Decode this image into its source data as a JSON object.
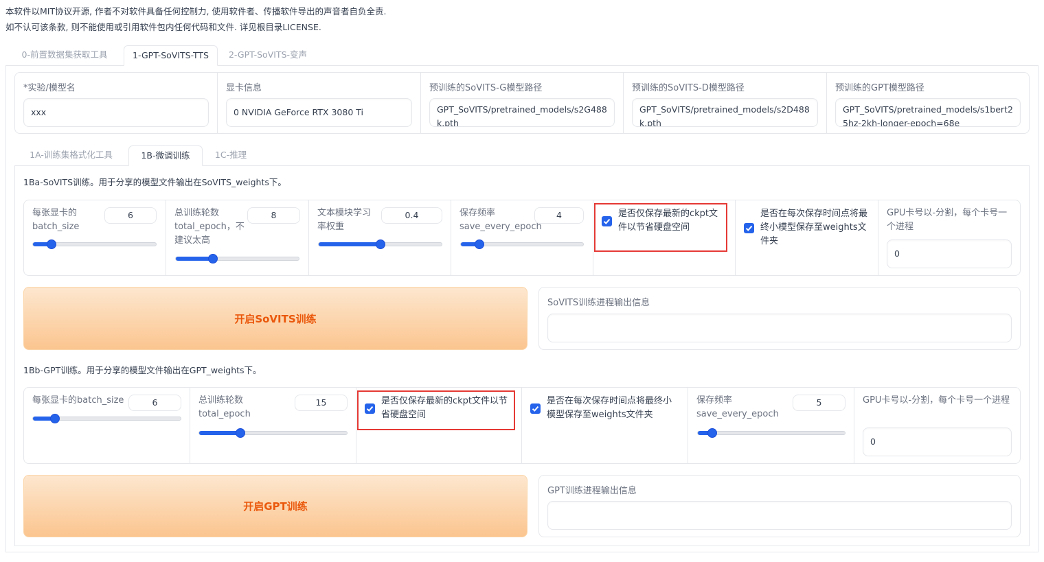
{
  "notice": {
    "line1": "本软件以MIT协议开源, 作者不对软件具备任何控制力, 使用软件者、传播软件导出的声音者自负全责.",
    "line2": "如不认可该条款, 则不能使用或引用软件包内任何代码和文件. 详见根目录LICENSE."
  },
  "top_tabs": [
    "0-前置数据集获取工具",
    "1-GPT-SoVITS-TTS",
    "2-GPT-SoVITS-变声"
  ],
  "config": {
    "exp_name_label": "*实验/模型名",
    "exp_name_value": "xxx",
    "gpu_info_label": "显卡信息",
    "gpu_info_value": "0 NVIDIA GeForce RTX 3080 Ti",
    "sovits_g_label": "预训练的SoVITS-G模型路径",
    "sovits_g_value": "GPT_SoVITS/pretrained_models/s2G488k.pth",
    "sovits_d_label": "预训练的SoVITS-D模型路径",
    "sovits_d_value": "GPT_SoVITS/pretrained_models/s2D488k.pth",
    "gpt_label": "预训练的GPT模型路径",
    "gpt_value": "GPT_SoVITS/pretrained_models/s1bert25hz-2kh-longer-epoch=68e"
  },
  "sub_tabs": [
    "1A-训练集格式化工具",
    "1B-微调训练",
    "1C-推理"
  ],
  "sovits": {
    "title": "1Ba-SoVITS训练。用于分享的模型文件输出在SoVITS_weights下。",
    "batch_label": "每张显卡的batch_size",
    "batch_value": "6",
    "batch_frac": 0.15,
    "epoch_label": "总训练轮数total_epoch，不建议太高",
    "epoch_value": "8",
    "epoch_frac": 0.3,
    "text_lr_label": "文本模块学习率权重",
    "text_lr_value": "0.4",
    "text_lr_frac": 0.5,
    "save_every_label": "保存频率save_every_epoch",
    "save_every_value": "4",
    "save_every_frac": 0.15,
    "if_save_latest": "是否仅保存最新的ckpt文件以节省硬盘空间",
    "if_save_every_weights": "是否在每次保存时间点将最终小模型保存至weights文件夹",
    "gpu_numbers_label": "GPU卡号以-分割，每个卡号一个进程",
    "gpu_numbers_value": "0",
    "start_button": "开启SoVITS训练",
    "output_label": "SoVITS训练进程输出信息"
  },
  "gpt": {
    "title": "1Bb-GPT训练。用于分享的模型文件输出在GPT_weights下。",
    "batch_label": "每张显卡的batch_size",
    "batch_value": "6",
    "batch_frac": 0.15,
    "epoch_label": "总训练轮数total_epoch",
    "epoch_value": "15",
    "epoch_frac": 0.28,
    "if_save_latest": "是否仅保存最新的ckpt文件以节省硬盘空间",
    "if_save_every_weights": "是否在每次保存时间点将最终小模型保存至weights文件夹",
    "save_every_label": "保存频率save_every_epoch",
    "save_every_value": "5",
    "save_every_frac": 0.1,
    "gpu_numbers_label": "GPU卡号以-分割，每个卡号一个进程",
    "gpu_numbers_value": "0",
    "start_button": "开启GPT训练",
    "output_label": "GPT训练进程输出信息"
  },
  "colors": {
    "accent": "#2563eb",
    "button_text": "#ea580c",
    "highlight": "#e53935"
  }
}
